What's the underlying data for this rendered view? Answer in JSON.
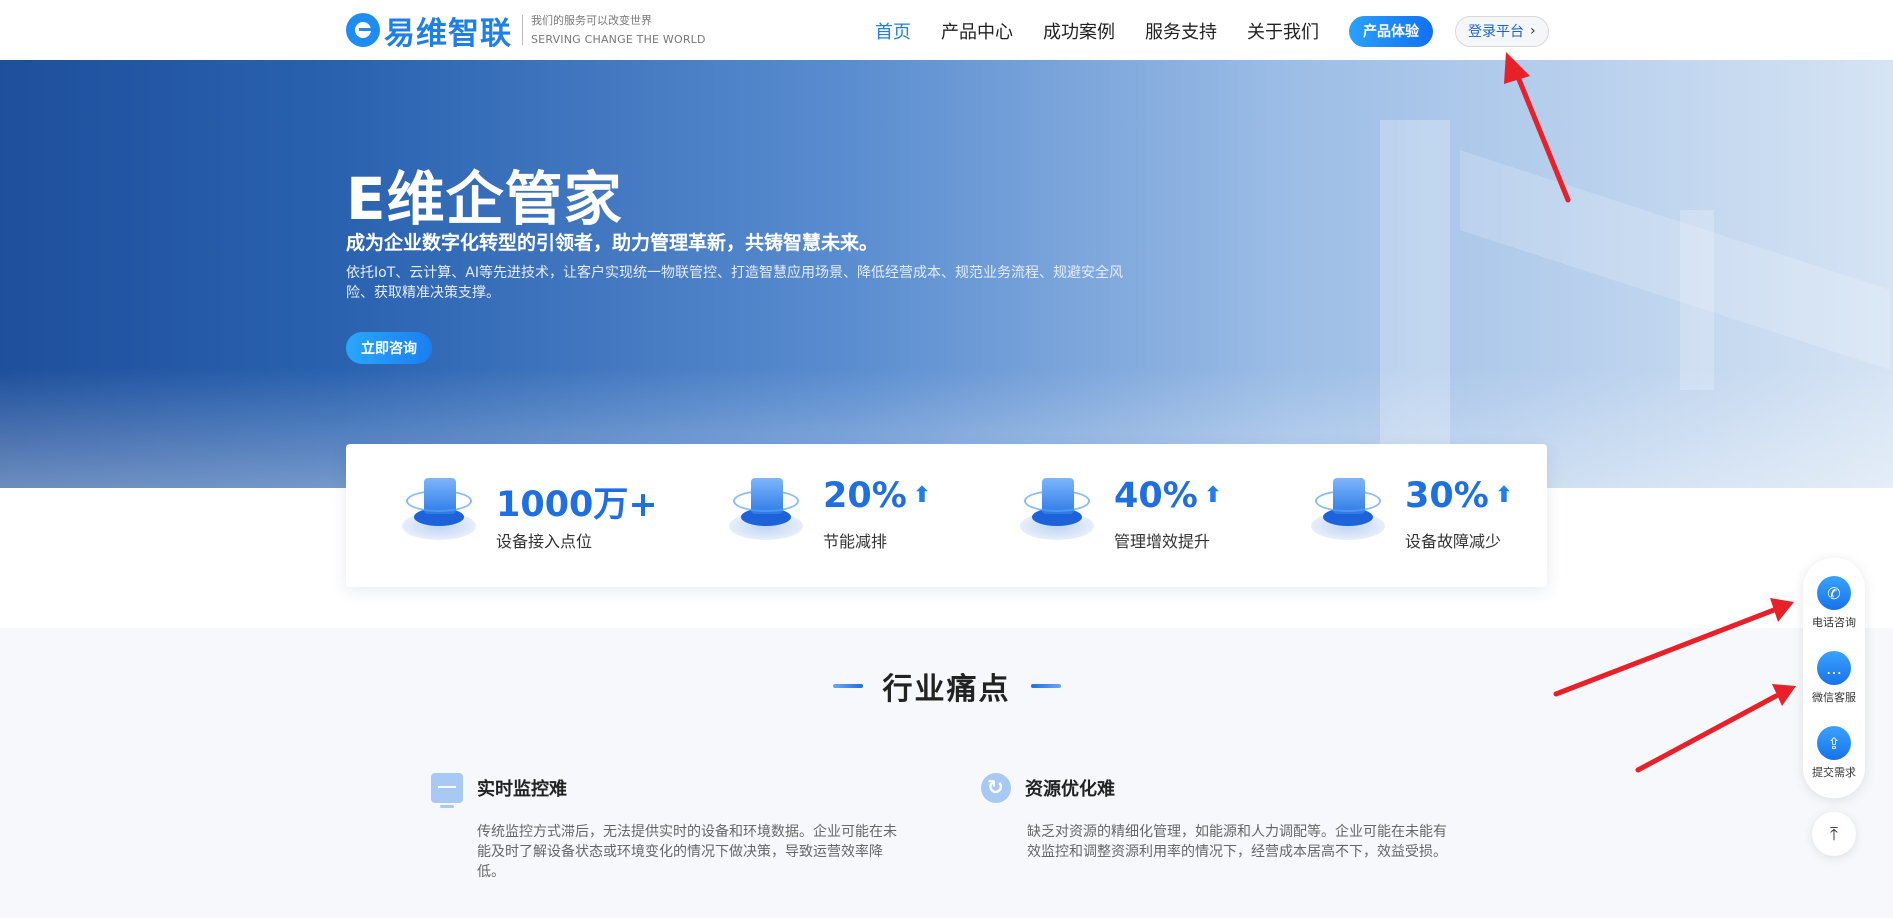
{
  "header": {
    "logo_name": "易维智联",
    "slogan_cn": "我们的服务可以改变世界",
    "slogan_en": "SERVING CHANGE THE WORLD",
    "nav": [
      {
        "label": "首页",
        "active": true
      },
      {
        "label": "产品中心",
        "active": false
      },
      {
        "label": "成功案例",
        "active": false
      },
      {
        "label": "服务支持",
        "active": false
      },
      {
        "label": "关于我们",
        "active": false
      }
    ],
    "trial_button": "产品体验",
    "login_button": "登录平台",
    "login_icon": "chevron-right-icon"
  },
  "hero": {
    "title": "E维企管家",
    "subtitle": "成为企业数字化转型的引领者，助力管理革新，共铸智慧未来。",
    "description": "依托IoT、云计算、AI等先进技术，让客户实现统一物联管控、打造智慧应用场景、降低经营成本、规范业务流程、规避安全风险、获取精准决策支撑。",
    "cta": "立即咨询"
  },
  "stats": [
    {
      "value": "1000万+",
      "label": "设备接入点位",
      "arrow": false
    },
    {
      "value": "20%",
      "label": "节能减排",
      "arrow": true
    },
    {
      "value": "40%",
      "label": "管理增效提升",
      "arrow": true
    },
    {
      "value": "30%",
      "label": "设备故障减少",
      "arrow": true
    }
  ],
  "section": {
    "title": "行业痛点",
    "pains": [
      {
        "title": "实时监控难",
        "icon": "monitor-icon",
        "description": "传统监控方式滞后，无法提供实时的设备和环境数据。企业可能在未能及时了解设备状态或环境变化的情况下做决策，导致运营效率降低。"
      },
      {
        "title": "资源优化难",
        "icon": "refresh-icon",
        "description": "缺乏对资源的精细化管理，如能源和人力调配等。企业可能在未能有效监控和调整资源利用率的情况下，经营成本居高不下，效益受损。"
      }
    ]
  },
  "side_panel": {
    "items": [
      {
        "label": "电话咨询",
        "icon": "phone-icon"
      },
      {
        "label": "微信客服",
        "icon": "chat-icon"
      },
      {
        "label": "提交需求",
        "icon": "submit-icon"
      }
    ],
    "back_top_icon": "back-to-top-icon"
  },
  "colors": {
    "brand": "#1f7fe6",
    "annotation": "#e8202a"
  }
}
